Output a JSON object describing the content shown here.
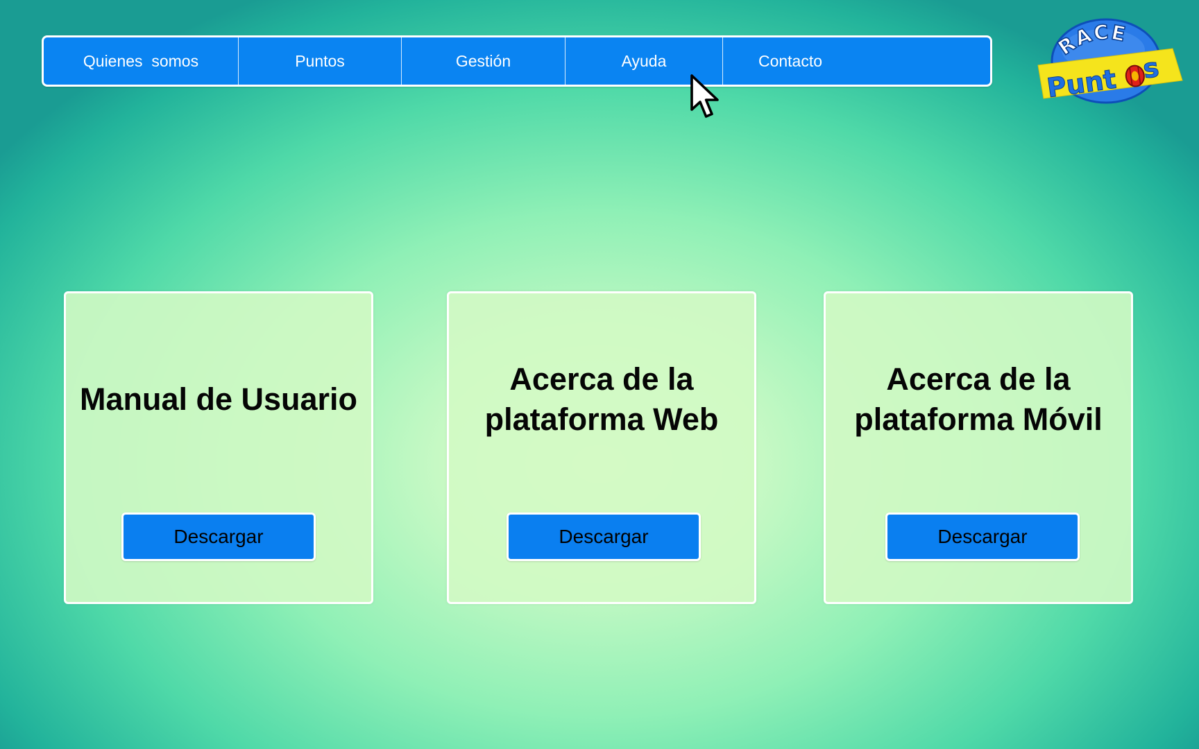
{
  "nav": {
    "items": [
      {
        "label": "Quienes  somos"
      },
      {
        "label": "Puntos"
      },
      {
        "label": "Gestión"
      },
      {
        "label": "Ayuda"
      },
      {
        "label": "Contacto"
      }
    ]
  },
  "logo": {
    "line1": "RACE",
    "line2": "Puntos"
  },
  "cards": [
    {
      "title_lines": [
        "Manual de Usuario"
      ],
      "button_label": "Descargar"
    },
    {
      "title_lines": [
        "Acerca de la",
        "plataforma Web"
      ],
      "button_label": "Descargar"
    },
    {
      "title_lines": [
        "Acerca de la",
        "plataforma Móvil"
      ],
      "button_label": "Descargar"
    }
  ],
  "colors": {
    "nav_background": "#0a84f2",
    "button_background": "#0a7ff0",
    "card_background": "#d2fac4",
    "logo_yellow": "#f5e41c",
    "logo_blue": "#1f6fe0"
  },
  "icons": {
    "cursor": "mouse-pointer-icon"
  }
}
